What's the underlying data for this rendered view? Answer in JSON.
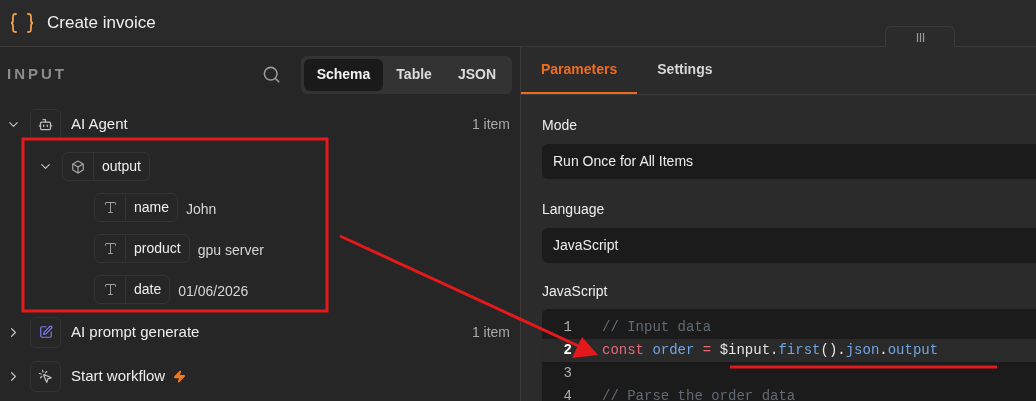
{
  "window": {
    "title": "Create invoice"
  },
  "input_panel": {
    "heading": "INPUT",
    "view_tabs": [
      {
        "label": "Schema",
        "selected": true
      },
      {
        "label": "Table",
        "selected": false
      },
      {
        "label": "JSON",
        "selected": false
      }
    ],
    "tree": [
      {
        "label": "AI Agent",
        "kind": "agent",
        "count": "1 item",
        "expanded": true,
        "children": [
          {
            "label": "output",
            "kind": "object",
            "expanded": true,
            "children": [
              {
                "label": "name",
                "kind": "string",
                "value": "John"
              },
              {
                "label": "product",
                "kind": "string",
                "value": "gpu server"
              },
              {
                "label": "date",
                "kind": "string",
                "value": "01/06/2026"
              }
            ]
          }
        ]
      },
      {
        "label": "AI prompt generate",
        "kind": "edit",
        "count": "1 item",
        "expanded": false
      },
      {
        "label": "Start workflow",
        "kind": "trigger",
        "expanded": false,
        "trigger": true
      }
    ]
  },
  "parameters_panel": {
    "tabs": [
      {
        "label": "Parameters",
        "selected": true
      },
      {
        "label": "Settings",
        "selected": false
      }
    ],
    "fields": [
      {
        "label": "Mode",
        "value": "Run Once for All Items"
      },
      {
        "label": "Language",
        "value": "JavaScript"
      }
    ],
    "code_editor": {
      "label": "JavaScript",
      "lines": [
        {
          "number": "1",
          "selected": false,
          "tokens": [
            {
              "kind": "comment",
              "text": "// Input data"
            }
          ]
        },
        {
          "number": "2",
          "selected": true,
          "tokens": [
            {
              "kind": "keyword",
              "text": "const"
            },
            {
              "kind": "variable",
              "text": " order"
            },
            {
              "kind": "keyword",
              "text": " ="
            },
            {
              "kind": "plain",
              "text": " $input."
            },
            {
              "kind": "variable",
              "text": "first"
            },
            {
              "kind": "plain",
              "text": "()."
            },
            {
              "kind": "variable",
              "text": "json"
            },
            {
              "kind": "plain",
              "text": "."
            },
            {
              "kind": "variable",
              "text": "output"
            }
          ]
        },
        {
          "number": "3",
          "selected": false
        },
        {
          "number": "4",
          "selected": false,
          "tokens": [
            {
              "kind": "comment",
              "text": "// Parse the order data"
            }
          ]
        }
      ]
    }
  }
}
